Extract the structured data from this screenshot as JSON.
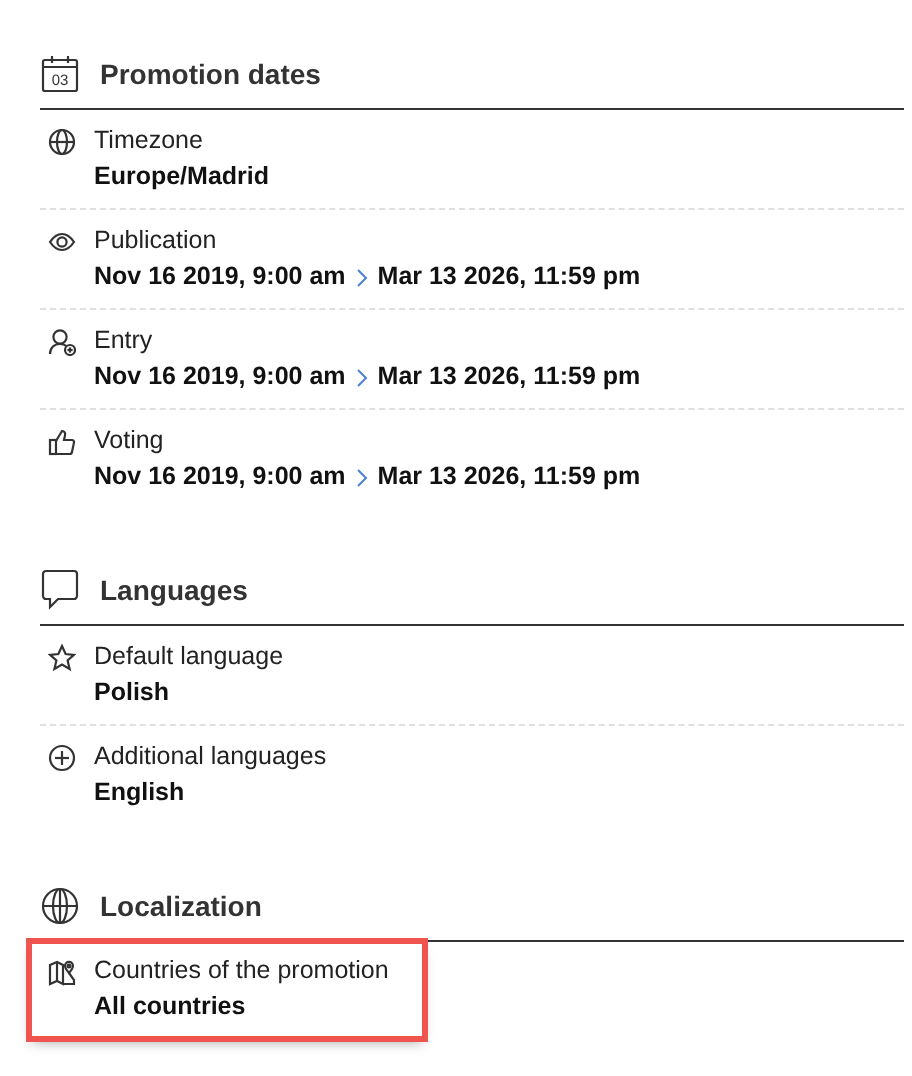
{
  "sections": [
    {
      "title": "Promotion dates",
      "icon_text": "03",
      "rows": [
        {
          "kind": "value",
          "label": "Timezone",
          "value": "Europe/Madrid",
          "highlighted": false
        },
        {
          "kind": "range",
          "label": "Publication",
          "from": "Nov 16 2019, 9:00 am",
          "to": "Mar 13 2026, 11:59 pm",
          "highlighted": false
        },
        {
          "kind": "range",
          "label": "Entry",
          "from": "Nov 16 2019, 9:00 am",
          "to": "Mar 13 2026, 11:59 pm",
          "highlighted": false
        },
        {
          "kind": "range",
          "label": "Voting",
          "from": "Nov 16 2019, 9:00 am",
          "to": "Mar 13 2026, 11:59 pm",
          "highlighted": false
        }
      ]
    },
    {
      "title": "Languages",
      "rows": [
        {
          "kind": "value",
          "label": "Default language",
          "value": "Polish",
          "highlighted": false
        },
        {
          "kind": "value",
          "label": "Additional languages",
          "value": "English",
          "highlighted": false
        }
      ]
    },
    {
      "title": "Localization",
      "rows": [
        {
          "kind": "value",
          "label": "Countries of the promotion",
          "value": "All countries",
          "highlighted": true
        }
      ]
    }
  ]
}
